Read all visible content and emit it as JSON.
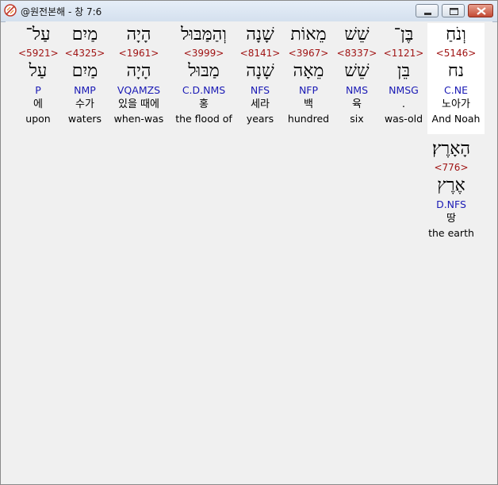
{
  "window": {
    "title": "@원전본해 - 창 7:6"
  },
  "rows": [
    {
      "words": [
        {
          "hebrew": "וְנֹחַ",
          "strong": "<5146>",
          "lemma": "נח",
          "morph": "C.NE",
          "korean": "노아가",
          "english": "And Noah",
          "selected": true
        },
        {
          "hebrew": "בֶּן־",
          "strong": "<1121>",
          "lemma": "בֵּן",
          "morph": "NMSG",
          "korean": ".",
          "english": "was-old",
          "selected": false
        },
        {
          "hebrew": "שֵׁשׁ",
          "strong": "<8337>",
          "lemma": "שֵׁשׁ",
          "morph": "NMS",
          "korean": "육",
          "english": "six",
          "selected": false
        },
        {
          "hebrew": "מֵאוֹת",
          "strong": "<3967>",
          "lemma": "מֵאָה",
          "morph": "NFP",
          "korean": "백",
          "english": "hundred",
          "selected": false
        },
        {
          "hebrew": "שָׁנָה",
          "strong": "<8141>",
          "lemma": "שָׁנָה",
          "morph": "NFS",
          "korean": "세라",
          "english": "years",
          "selected": false
        },
        {
          "hebrew": "וְהַמַּבּוּל",
          "strong": "<3999>",
          "lemma": "מַבּוּל",
          "morph": "C.D.NMS",
          "korean": "홍",
          "english": "the flood of",
          "selected": false
        },
        {
          "hebrew": "הָיָה",
          "strong": "<1961>",
          "lemma": "הָיָה",
          "morph": "VQAMZS",
          "korean": "있을 때에",
          "english": "when-was",
          "selected": false
        },
        {
          "hebrew": "מַיִם",
          "strong": "<4325>",
          "lemma": "מַיִם",
          "morph": "NMP",
          "korean": "수가",
          "english": "waters",
          "selected": false
        },
        {
          "hebrew": "עַל־",
          "strong": "<5921>",
          "lemma": "עַל",
          "morph": "P",
          "korean": "에",
          "english": "upon",
          "selected": false
        }
      ]
    },
    {
      "words": [
        {
          "hebrew": "הָאָרֶץ׃",
          "strong": "<776>",
          "lemma": "אֶרֶץ",
          "morph": "D.NFS",
          "korean": "땅",
          "english": "the earth",
          "selected": false
        }
      ]
    }
  ]
}
